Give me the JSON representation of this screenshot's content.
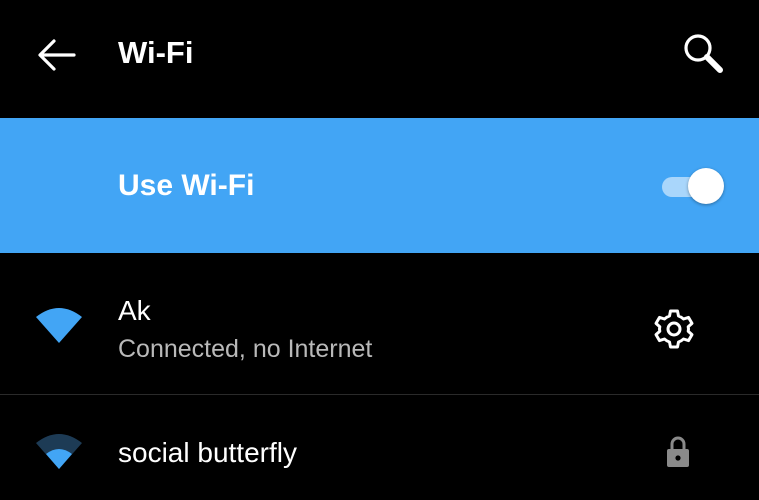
{
  "colors": {
    "background": "#000000",
    "accent": "#42a5f5",
    "text_primary": "#ffffff",
    "text_secondary": "#b9b9b9",
    "lock_icon": "#8a8a8a"
  },
  "appbar": {
    "title": "Wi-Fi",
    "back_icon": "arrow-left-icon",
    "search_icon": "search-icon"
  },
  "master_switch": {
    "label": "Use Wi-Fi",
    "state": "on"
  },
  "networks": [
    {
      "name": "Ak",
      "status": "Connected, no Internet",
      "signal_level": 1.0,
      "action_icon": "gear-icon"
    },
    {
      "name": "social butterfly",
      "status": "",
      "signal_level": 0.5,
      "secured": true,
      "action_icon": "lock-icon"
    }
  ]
}
